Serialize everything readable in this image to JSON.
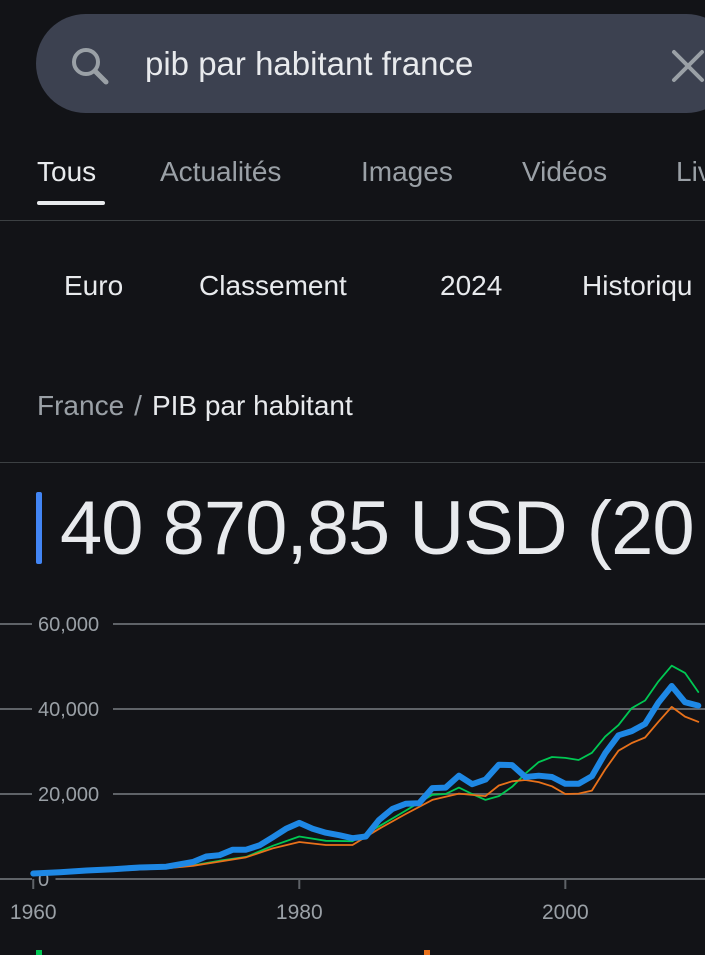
{
  "search": {
    "query": "pib par habitant france",
    "search_icon": "search-icon",
    "clear_icon": "close-icon"
  },
  "tabs": [
    {
      "label": "Tous",
      "active": true
    },
    {
      "label": "Actualités",
      "active": false
    },
    {
      "label": "Images",
      "active": false
    },
    {
      "label": "Vidéos",
      "active": false
    },
    {
      "label": "Liv",
      "active": false
    }
  ],
  "chips": [
    {
      "label": "Euro"
    },
    {
      "label": "Classement"
    },
    {
      "label": "2024"
    },
    {
      "label": "Historiqu"
    }
  ],
  "breadcrumb": {
    "country": "France",
    "separator": "/",
    "current": "PIB par habitant"
  },
  "headline": {
    "value": "40 870,85 USD (20",
    "accent_color": "#4285f4"
  },
  "chart_data": {
    "type": "line",
    "title": "",
    "xlabel": "",
    "ylabel": "",
    "x_ticks": [
      "1960",
      "1980",
      "2000"
    ],
    "y_ticks": [
      "0",
      "20,000",
      "40,000",
      "60,000"
    ],
    "xlim": [
      1957.5,
      2010.5
    ],
    "ylim": [
      0,
      60000
    ],
    "grid": true,
    "series": [
      {
        "color": "#1e88e5",
        "x": [
          1960,
          1962,
          1964,
          1966,
          1968,
          1970,
          1972,
          1973,
          1974,
          1975,
          1976,
          1977,
          1978,
          1979,
          1980,
          1981,
          1982,
          1983,
          1984,
          1985,
          1986,
          1987,
          1988,
          1989,
          1990,
          1991,
          1992,
          1993,
          1994,
          1995,
          1996,
          1997,
          1998,
          1999,
          2000,
          2001,
          2002,
          2003,
          2004,
          2005,
          2006,
          2007,
          2008,
          2009,
          2010
        ],
        "y": [
          1300,
          1600,
          2000,
          2300,
          2700,
          2900,
          4000,
          5300,
          5600,
          6900,
          6900,
          7900,
          9800,
          11800,
          13200,
          11800,
          10900,
          10300,
          9600,
          10000,
          13900,
          16500,
          17700,
          17800,
          21400,
          21500,
          24300,
          22300,
          23400,
          26900,
          26800,
          24000,
          24300,
          24000,
          22400,
          22400,
          24200,
          29600,
          33800,
          34800,
          36500,
          41500,
          45400,
          41600,
          40800
        ],
        "width": 6
      },
      {
        "color": "#00c853",
        "x": [
          1960,
          1964,
          1968,
          1970,
          1972,
          1974,
          1976,
          1978,
          1980,
          1982,
          1984,
          1986,
          1988,
          1990,
          1991,
          1992,
          1993,
          1994,
          1995,
          1996,
          1997,
          1998,
          1999,
          2000,
          2001,
          2002,
          2003,
          2004,
          2005,
          2006,
          2007,
          2008,
          2009,
          2010
        ],
        "y": [
          1200,
          1800,
          2400,
          2700,
          3200,
          4300,
          5200,
          7800,
          10000,
          9000,
          8900,
          12400,
          16100,
          19800,
          20000,
          21500,
          20000,
          18600,
          19500,
          21700,
          24800,
          27500,
          28700,
          28500,
          28000,
          29700,
          33500,
          36200,
          40200,
          42000,
          46500,
          50200,
          48500,
          44000
        ],
        "width": 1.8
      },
      {
        "color": "#e8711a",
        "x": [
          1960,
          1964,
          1968,
          1970,
          1972,
          1974,
          1976,
          1978,
          1980,
          1982,
          1984,
          1986,
          1988,
          1990,
          1992,
          1994,
          1995,
          1996,
          1997,
          1998,
          1999,
          2000,
          2001,
          2002,
          2003,
          2004,
          2005,
          2006,
          2007,
          2008,
          2009,
          2010
        ],
        "y": [
          1100,
          1700,
          2200,
          2500,
          3100,
          4100,
          5100,
          7200,
          8700,
          8000,
          8000,
          11800,
          15300,
          18600,
          20100,
          19500,
          22000,
          23000,
          23300,
          22800,
          21800,
          20000,
          20100,
          20800,
          25800,
          30200,
          32000,
          33300,
          37000,
          40500,
          38200,
          37000
        ],
        "width": 1.8
      }
    ]
  }
}
